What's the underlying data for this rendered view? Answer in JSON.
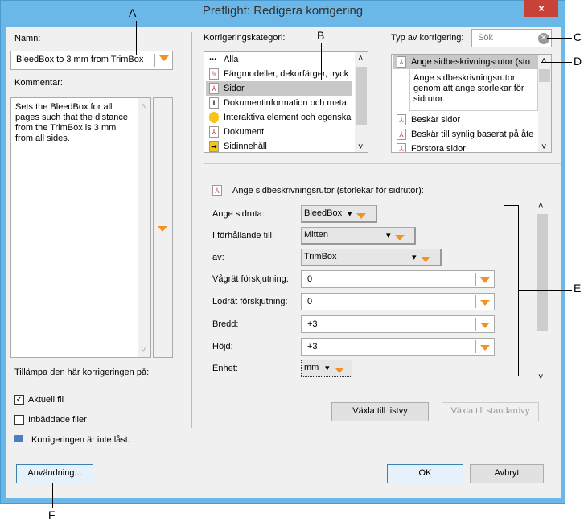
{
  "window": {
    "title": "Preflight: Redigera korrigering",
    "close": "×"
  },
  "left": {
    "name_label": "Namn:",
    "name_value": "BleedBox to 3 mm from TrimBox",
    "comment_label": "Kommentar:",
    "comment": "Sets the BleedBox for all pages such that the distance from the TrimBox is 3 mm from all sides.",
    "apply_label": "Tillämpa den här korrigeringen på:",
    "current_file": "Aktuell fil",
    "current_file_checked": true,
    "embedded_files": "Inbäddade filer",
    "embedded_files_checked": false,
    "lock_text": "Korrigeringen är inte låst.",
    "usage_button": "Användning..."
  },
  "middle": {
    "label": "Korrigeringskategori:",
    "items": [
      "Alla",
      "Färgmodeller, dekorfärger, tryck",
      "Sidor",
      "Dokumentinformation och meta",
      "Interaktiva element och egenska",
      "Dokument",
      "Sidinnehåll"
    ],
    "selected": 2
  },
  "right": {
    "label": "Typ av korrigering:",
    "search_placeholder": "Sök",
    "selected_item": "Ange sidbeskrivningsrutor (sto",
    "selected_desc": "Ange sidbeskrivningsrutor genom att ange storlekar för sidrutor.",
    "items": [
      "Beskär sidor",
      "Beskär till synlig baserat på åte",
      "Förstora sidor"
    ]
  },
  "panel": {
    "title": "Ange sidbeskrivningsrutor (storlekar för sidrutor):",
    "rows": [
      {
        "label": "Ange sidruta:",
        "value": "BleedBox"
      },
      {
        "label": "I förhållande till:",
        "value": "Mitten"
      },
      {
        "label": "av:",
        "value": "TrimBox"
      },
      {
        "label": "Vågrät förskjutning:",
        "value": "0"
      },
      {
        "label": "Lodrät förskjutning:",
        "value": "0"
      },
      {
        "label": "Bredd:",
        "value": "+3"
      },
      {
        "label": "Höjd:",
        "value": "+3"
      },
      {
        "label": "Enhet:",
        "value": "mm"
      }
    ],
    "list_view_button": "Växla till listvy",
    "standard_view_button": "Växla till standardvy"
  },
  "footer": {
    "ok": "OK",
    "cancel": "Avbryt"
  },
  "callouts": {
    "a": "A",
    "b": "B",
    "c": "C",
    "d": "D",
    "e": "E",
    "f": "F"
  },
  "colors": {
    "accent": "#f39220",
    "titlebar": "#6bb7e8",
    "close": "#c9423a"
  }
}
